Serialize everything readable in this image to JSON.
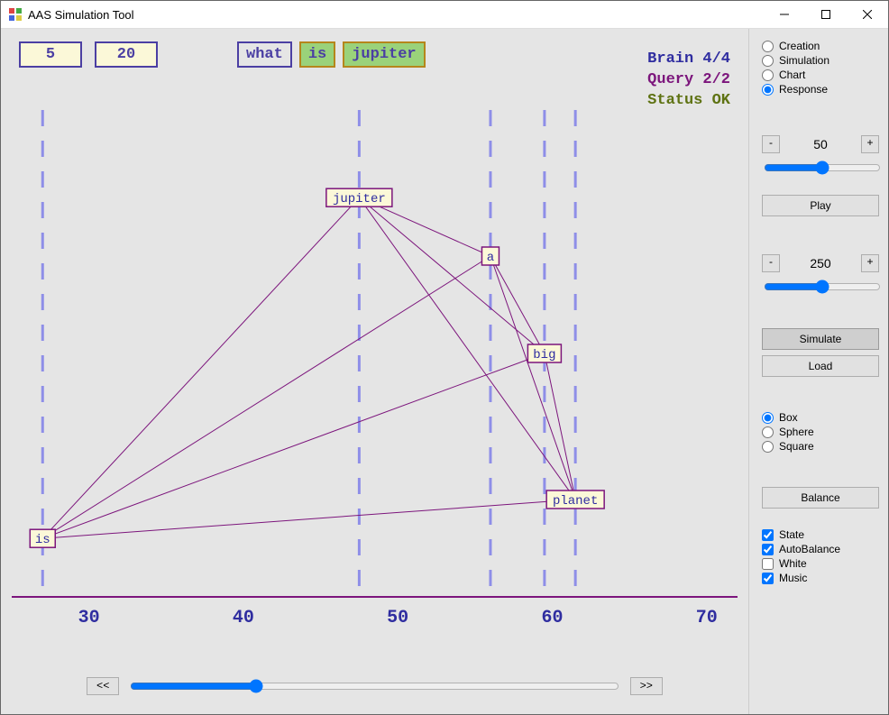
{
  "window": {
    "title": "AAS Simulation Tool"
  },
  "top": {
    "num1": "5",
    "num2": "20",
    "words": [
      {
        "text": "what",
        "cls": "wordbox"
      },
      {
        "text": "is",
        "cls": "wordbox g1"
      },
      {
        "text": "jupiter",
        "cls": "wordbox g2"
      }
    ]
  },
  "status": {
    "brain": "Brain 4/4",
    "query": "Query 2/2",
    "ok": "Status OK"
  },
  "sidebar": {
    "mode": {
      "options": [
        "Creation",
        "Simulation",
        "Chart",
        "Response"
      ],
      "selected": "Response"
    },
    "spin1": "50",
    "play": "Play",
    "spin2": "250",
    "simulate": "Simulate",
    "load": "Load",
    "shape": {
      "options": [
        "Box",
        "Sphere",
        "Square"
      ],
      "selected": "Box"
    },
    "balance": "Balance",
    "checks": [
      {
        "label": "State",
        "checked": true
      },
      {
        "label": "AutoBalance",
        "checked": true
      },
      {
        "label": "White",
        "checked": false
      },
      {
        "label": "Music",
        "checked": true
      }
    ]
  },
  "nav": {
    "prev": "<<",
    "next": ">>"
  },
  "chart_data": {
    "type": "scatter",
    "xlabel": "",
    "ylabel": "",
    "xlim": [
      25,
      72
    ],
    "y_axis_visible": false,
    "ticks": [
      30,
      40,
      50,
      60,
      70
    ],
    "guides": [
      27,
      47.5,
      56,
      59.5,
      61.5
    ],
    "baselineColor": "#7c157c",
    "nodeBorder": "#7c157c",
    "edgeColor": "#7c157c",
    "tickColor": "#2f2da0",
    "guideColor": "#8e8ee8",
    "nodes": [
      {
        "id": "is",
        "label": "is",
        "x": 27.0,
        "y": 0.12
      },
      {
        "id": "jupiter",
        "label": "jupiter",
        "x": 47.5,
        "y": 0.82
      },
      {
        "id": "a",
        "label": "a",
        "x": 56.0,
        "y": 0.7
      },
      {
        "id": "big",
        "label": "big",
        "x": 59.5,
        "y": 0.5
      },
      {
        "id": "planet",
        "label": "planet",
        "x": 61.5,
        "y": 0.2
      }
    ],
    "edges": [
      [
        "is",
        "jupiter"
      ],
      [
        "is",
        "a"
      ],
      [
        "is",
        "big"
      ],
      [
        "is",
        "planet"
      ],
      [
        "jupiter",
        "a"
      ],
      [
        "jupiter",
        "big"
      ],
      [
        "jupiter",
        "planet"
      ],
      [
        "a",
        "big"
      ],
      [
        "a",
        "planet"
      ],
      [
        "big",
        "planet"
      ]
    ]
  }
}
